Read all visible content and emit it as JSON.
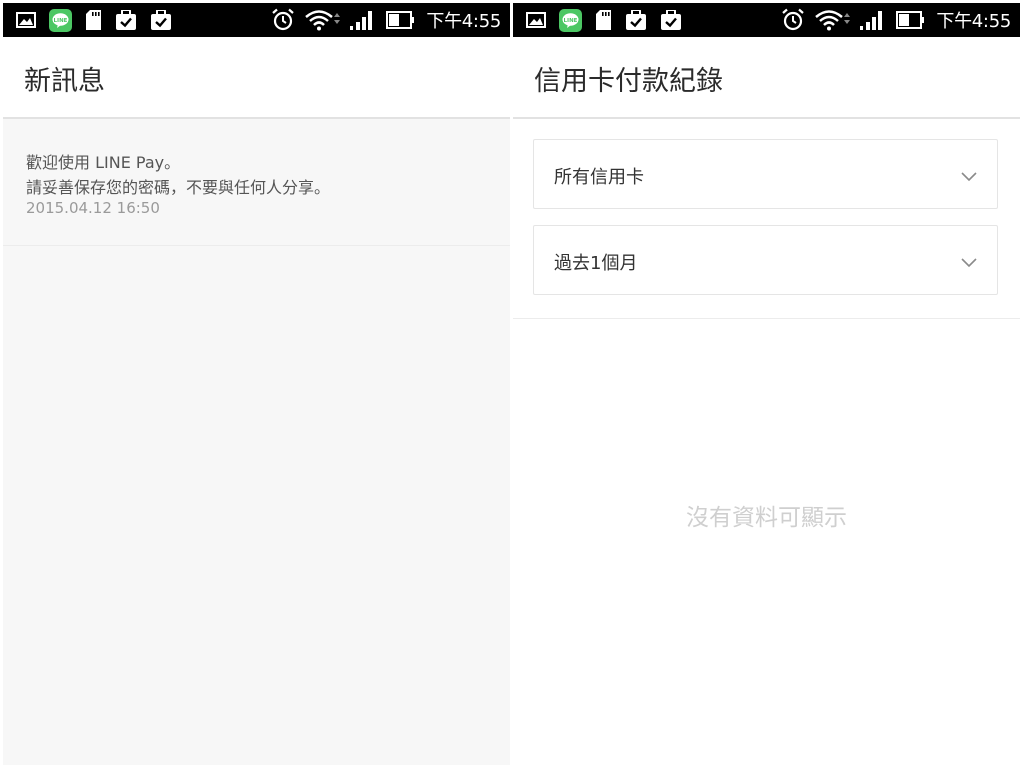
{
  "left": {
    "status": {
      "time": "下午4:55"
    },
    "appbar": {
      "title": "新訊息"
    },
    "messages": [
      {
        "line1": "歡迎使用 LINE Pay。",
        "line2": "請妥善保存您的密碼，不要與任何人分享。",
        "date": "2015.04.12 16:50"
      }
    ]
  },
  "right": {
    "status": {
      "time": "下午4:55"
    },
    "appbar": {
      "title": "信用卡付款紀錄"
    },
    "filters": {
      "card": {
        "selected": "所有信用卡"
      },
      "period": {
        "selected": "過去1個月"
      }
    },
    "empty_text": "沒有資料可顯示"
  },
  "colors": {
    "line_green": "#4cc764",
    "statusbar_bg": "#000000",
    "left_bg": "#f7f7f7",
    "empty_text": "#cfcfcf"
  },
  "status_icons": [
    "gallery-icon",
    "line-app-icon",
    "sd-card-icon",
    "task-check-icon",
    "task-check-icon",
    "alarm-icon",
    "wifi-icon",
    "signal-icon",
    "battery-icon"
  ]
}
